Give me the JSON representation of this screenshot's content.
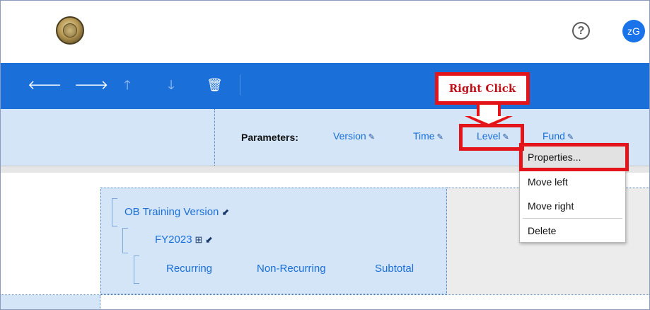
{
  "header": {
    "help_icon": "?",
    "avatar_initials": "zG"
  },
  "toolbar": {
    "icons": [
      "arrow-left-icon",
      "arrow-right-icon",
      "arrow-up-icon",
      "arrow-down-icon",
      "trash-icon"
    ],
    "glyphs": {
      "back": "🡐",
      "forward": "🡒",
      "up": "🡑",
      "down": "🡓",
      "delete": "🗑"
    }
  },
  "parameters": {
    "label": "Parameters:",
    "items": [
      {
        "label": "Version",
        "pin": "✎"
      },
      {
        "label": "Time",
        "pin": "✎"
      },
      {
        "label": "Level",
        "pin": "✎"
      },
      {
        "label": "Fund",
        "pin": "✎"
      }
    ]
  },
  "annotation": {
    "callout_text": "Right Click",
    "color": "#e4141b"
  },
  "context_menu": {
    "items": [
      {
        "label": "Properties...",
        "active": true
      },
      {
        "label": "Move left",
        "active": false
      },
      {
        "label": "Move right",
        "active": false
      },
      {
        "label": "Delete",
        "active": false
      }
    ]
  },
  "row_headers": {
    "level1": {
      "label": "OB Training Version",
      "glyph": "⬋"
    },
    "level2": {
      "label": "FY2023",
      "glyphs": "⊞ ⬋"
    },
    "level3": [
      "Recurring",
      "Non-Recurring",
      "Subtotal"
    ]
  },
  "colors": {
    "toolbar_blue": "#1a6fd8",
    "panel_blue": "#d4e5f7",
    "link_blue": "#1a6fd8",
    "annotation_red": "#e4141b"
  }
}
